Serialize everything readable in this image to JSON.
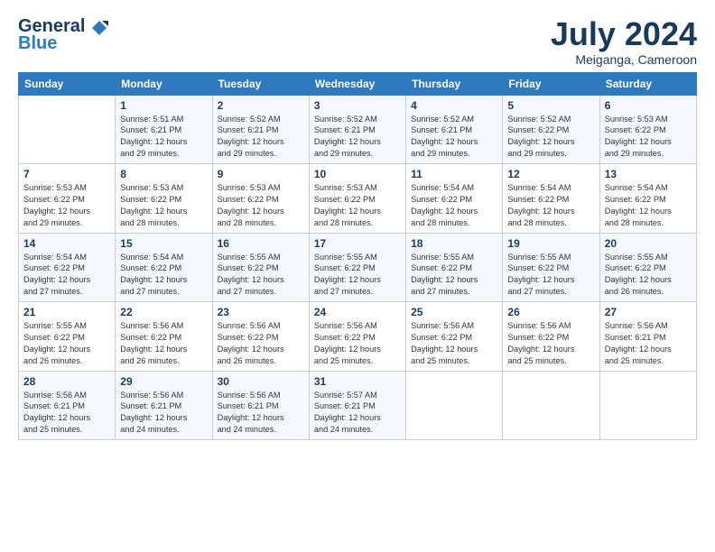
{
  "header": {
    "logo_line1": "General",
    "logo_line2": "Blue",
    "month_year": "July 2024",
    "location": "Meiganga, Cameroon"
  },
  "weekdays": [
    "Sunday",
    "Monday",
    "Tuesday",
    "Wednesday",
    "Thursday",
    "Friday",
    "Saturday"
  ],
  "weeks": [
    [
      {
        "day": "",
        "info": ""
      },
      {
        "day": "1",
        "info": "Sunrise: 5:51 AM\nSunset: 6:21 PM\nDaylight: 12 hours\nand 29 minutes."
      },
      {
        "day": "2",
        "info": "Sunrise: 5:52 AM\nSunset: 6:21 PM\nDaylight: 12 hours\nand 29 minutes."
      },
      {
        "day": "3",
        "info": "Sunrise: 5:52 AM\nSunset: 6:21 PM\nDaylight: 12 hours\nand 29 minutes."
      },
      {
        "day": "4",
        "info": "Sunrise: 5:52 AM\nSunset: 6:21 PM\nDaylight: 12 hours\nand 29 minutes."
      },
      {
        "day": "5",
        "info": "Sunrise: 5:52 AM\nSunset: 6:22 PM\nDaylight: 12 hours\nand 29 minutes."
      },
      {
        "day": "6",
        "info": "Sunrise: 5:53 AM\nSunset: 6:22 PM\nDaylight: 12 hours\nand 29 minutes."
      }
    ],
    [
      {
        "day": "7",
        "info": "Sunrise: 5:53 AM\nSunset: 6:22 PM\nDaylight: 12 hours\nand 29 minutes."
      },
      {
        "day": "8",
        "info": "Sunrise: 5:53 AM\nSunset: 6:22 PM\nDaylight: 12 hours\nand 28 minutes."
      },
      {
        "day": "9",
        "info": "Sunrise: 5:53 AM\nSunset: 6:22 PM\nDaylight: 12 hours\nand 28 minutes."
      },
      {
        "day": "10",
        "info": "Sunrise: 5:53 AM\nSunset: 6:22 PM\nDaylight: 12 hours\nand 28 minutes."
      },
      {
        "day": "11",
        "info": "Sunrise: 5:54 AM\nSunset: 6:22 PM\nDaylight: 12 hours\nand 28 minutes."
      },
      {
        "day": "12",
        "info": "Sunrise: 5:54 AM\nSunset: 6:22 PM\nDaylight: 12 hours\nand 28 minutes."
      },
      {
        "day": "13",
        "info": "Sunrise: 5:54 AM\nSunset: 6:22 PM\nDaylight: 12 hours\nand 28 minutes."
      }
    ],
    [
      {
        "day": "14",
        "info": "Sunrise: 5:54 AM\nSunset: 6:22 PM\nDaylight: 12 hours\nand 27 minutes."
      },
      {
        "day": "15",
        "info": "Sunrise: 5:54 AM\nSunset: 6:22 PM\nDaylight: 12 hours\nand 27 minutes."
      },
      {
        "day": "16",
        "info": "Sunrise: 5:55 AM\nSunset: 6:22 PM\nDaylight: 12 hours\nand 27 minutes."
      },
      {
        "day": "17",
        "info": "Sunrise: 5:55 AM\nSunset: 6:22 PM\nDaylight: 12 hours\nand 27 minutes."
      },
      {
        "day": "18",
        "info": "Sunrise: 5:55 AM\nSunset: 6:22 PM\nDaylight: 12 hours\nand 27 minutes."
      },
      {
        "day": "19",
        "info": "Sunrise: 5:55 AM\nSunset: 6:22 PM\nDaylight: 12 hours\nand 27 minutes."
      },
      {
        "day": "20",
        "info": "Sunrise: 5:55 AM\nSunset: 6:22 PM\nDaylight: 12 hours\nand 26 minutes."
      }
    ],
    [
      {
        "day": "21",
        "info": "Sunrise: 5:55 AM\nSunset: 6:22 PM\nDaylight: 12 hours\nand 26 minutes."
      },
      {
        "day": "22",
        "info": "Sunrise: 5:56 AM\nSunset: 6:22 PM\nDaylight: 12 hours\nand 26 minutes."
      },
      {
        "day": "23",
        "info": "Sunrise: 5:56 AM\nSunset: 6:22 PM\nDaylight: 12 hours\nand 26 minutes."
      },
      {
        "day": "24",
        "info": "Sunrise: 5:56 AM\nSunset: 6:22 PM\nDaylight: 12 hours\nand 25 minutes."
      },
      {
        "day": "25",
        "info": "Sunrise: 5:56 AM\nSunset: 6:22 PM\nDaylight: 12 hours\nand 25 minutes."
      },
      {
        "day": "26",
        "info": "Sunrise: 5:56 AM\nSunset: 6:22 PM\nDaylight: 12 hours\nand 25 minutes."
      },
      {
        "day": "27",
        "info": "Sunrise: 5:56 AM\nSunset: 6:21 PM\nDaylight: 12 hours\nand 25 minutes."
      }
    ],
    [
      {
        "day": "28",
        "info": "Sunrise: 5:56 AM\nSunset: 6:21 PM\nDaylight: 12 hours\nand 25 minutes."
      },
      {
        "day": "29",
        "info": "Sunrise: 5:56 AM\nSunset: 6:21 PM\nDaylight: 12 hours\nand 24 minutes."
      },
      {
        "day": "30",
        "info": "Sunrise: 5:56 AM\nSunset: 6:21 PM\nDaylight: 12 hours\nand 24 minutes."
      },
      {
        "day": "31",
        "info": "Sunrise: 5:57 AM\nSunset: 6:21 PM\nDaylight: 12 hours\nand 24 minutes."
      },
      {
        "day": "",
        "info": ""
      },
      {
        "day": "",
        "info": ""
      },
      {
        "day": "",
        "info": ""
      }
    ]
  ]
}
